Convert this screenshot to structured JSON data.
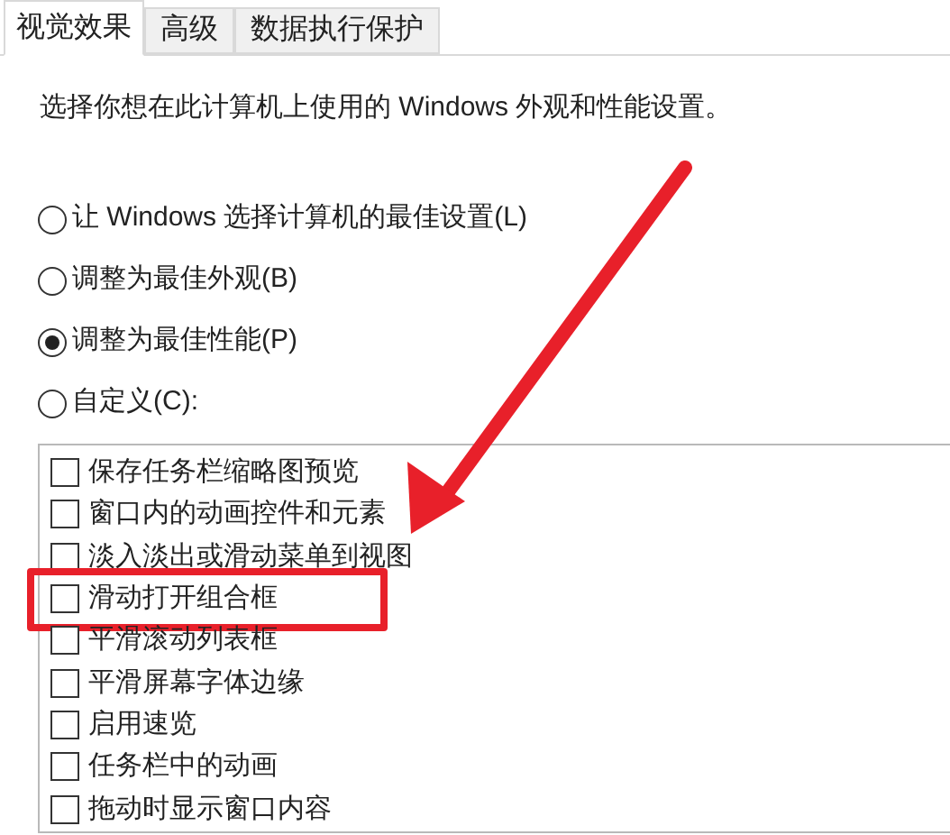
{
  "tabs": [
    {
      "label": "视觉效果",
      "selected": true
    },
    {
      "label": "高级",
      "selected": false
    },
    {
      "label": "数据执行保护",
      "selected": false
    }
  ],
  "description": "选择你想在此计算机上使用的 Windows 外观和性能设置。",
  "options": [
    {
      "label": "让 Windows 选择计算机的最佳设置(L)",
      "selected": false
    },
    {
      "label": "调整为最佳外观(B)",
      "selected": false
    },
    {
      "label": "调整为最佳性能(P)",
      "selected": true
    },
    {
      "label": "自定义(C):",
      "selected": false
    }
  ],
  "settings": [
    {
      "label": "保存任务栏缩略图预览",
      "checked": false,
      "highlighted": false
    },
    {
      "label": "窗口内的动画控件和元素",
      "checked": false,
      "highlighted": false
    },
    {
      "label": "淡入淡出或滑动菜单到视图",
      "checked": false,
      "highlighted": false
    },
    {
      "label": "滑动打开组合框",
      "checked": false,
      "highlighted": true
    },
    {
      "label": "平滑滚动列表框",
      "checked": false,
      "highlighted": false
    },
    {
      "label": "平滑屏幕字体边缘",
      "checked": false,
      "highlighted": false
    },
    {
      "label": "启用速览",
      "checked": false,
      "highlighted": false
    },
    {
      "label": "任务栏中的动画",
      "checked": false,
      "highlighted": false
    },
    {
      "label": "拖动时显示窗口内容",
      "checked": false,
      "highlighted": false
    }
  ],
  "annotations": [
    {
      "kind": "arrow"
    }
  ]
}
